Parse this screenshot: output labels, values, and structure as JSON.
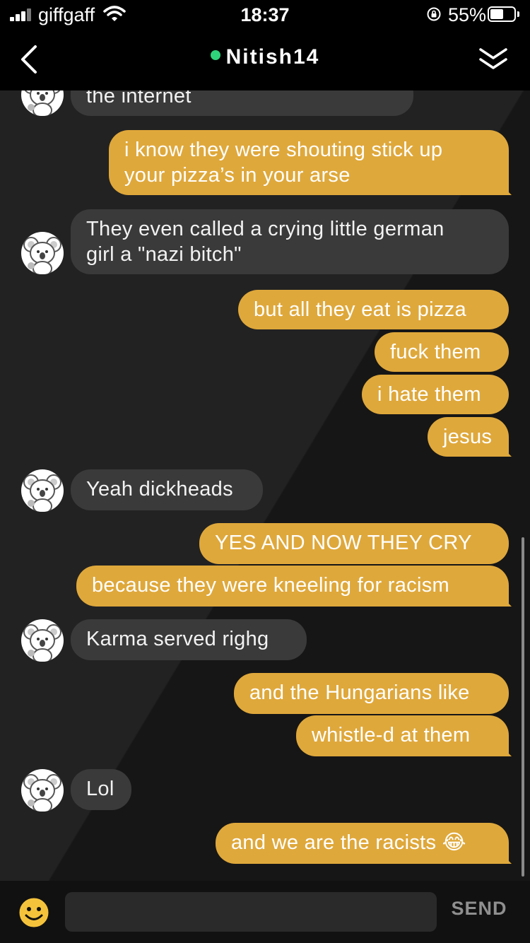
{
  "status": {
    "carrier": "giffgaff",
    "time": "18:37",
    "battery": "55%"
  },
  "header": {
    "title": "Nitish14",
    "online": true
  },
  "messages": [
    {
      "from": "them",
      "text": "the internet"
    },
    {
      "from": "me",
      "text": "i know they were shouting stick up",
      "text2": "your pizza’s in your arse"
    },
    {
      "from": "them",
      "text": "They even called a crying little german",
      "text2": "girl a \"nazi bitch\""
    },
    {
      "from": "me",
      "text": "but all they eat is pizza"
    },
    {
      "from": "me",
      "text": "fuck them"
    },
    {
      "from": "me",
      "text": "i hate them"
    },
    {
      "from": "me",
      "text": "jesus"
    },
    {
      "from": "them",
      "text": "Yeah dickheads"
    },
    {
      "from": "me",
      "text": "YES AND NOW THEY CRY"
    },
    {
      "from": "me",
      "text": "because they were kneeling for racism"
    },
    {
      "from": "them",
      "text": "Karma served righg"
    },
    {
      "from": "me",
      "text": "and the Hungarians like"
    },
    {
      "from": "me",
      "text": "whistle-d at them"
    },
    {
      "from": "them",
      "text": "Lol"
    },
    {
      "from": "me",
      "text": "and we are the racists",
      "emoji": "😂"
    }
  ],
  "input": {
    "placeholder": "",
    "send_label": "SEND"
  },
  "colors": {
    "my_bubble": "#dfa83b",
    "their_bubble": "#3a3a3a",
    "online": "#2fd37a"
  }
}
